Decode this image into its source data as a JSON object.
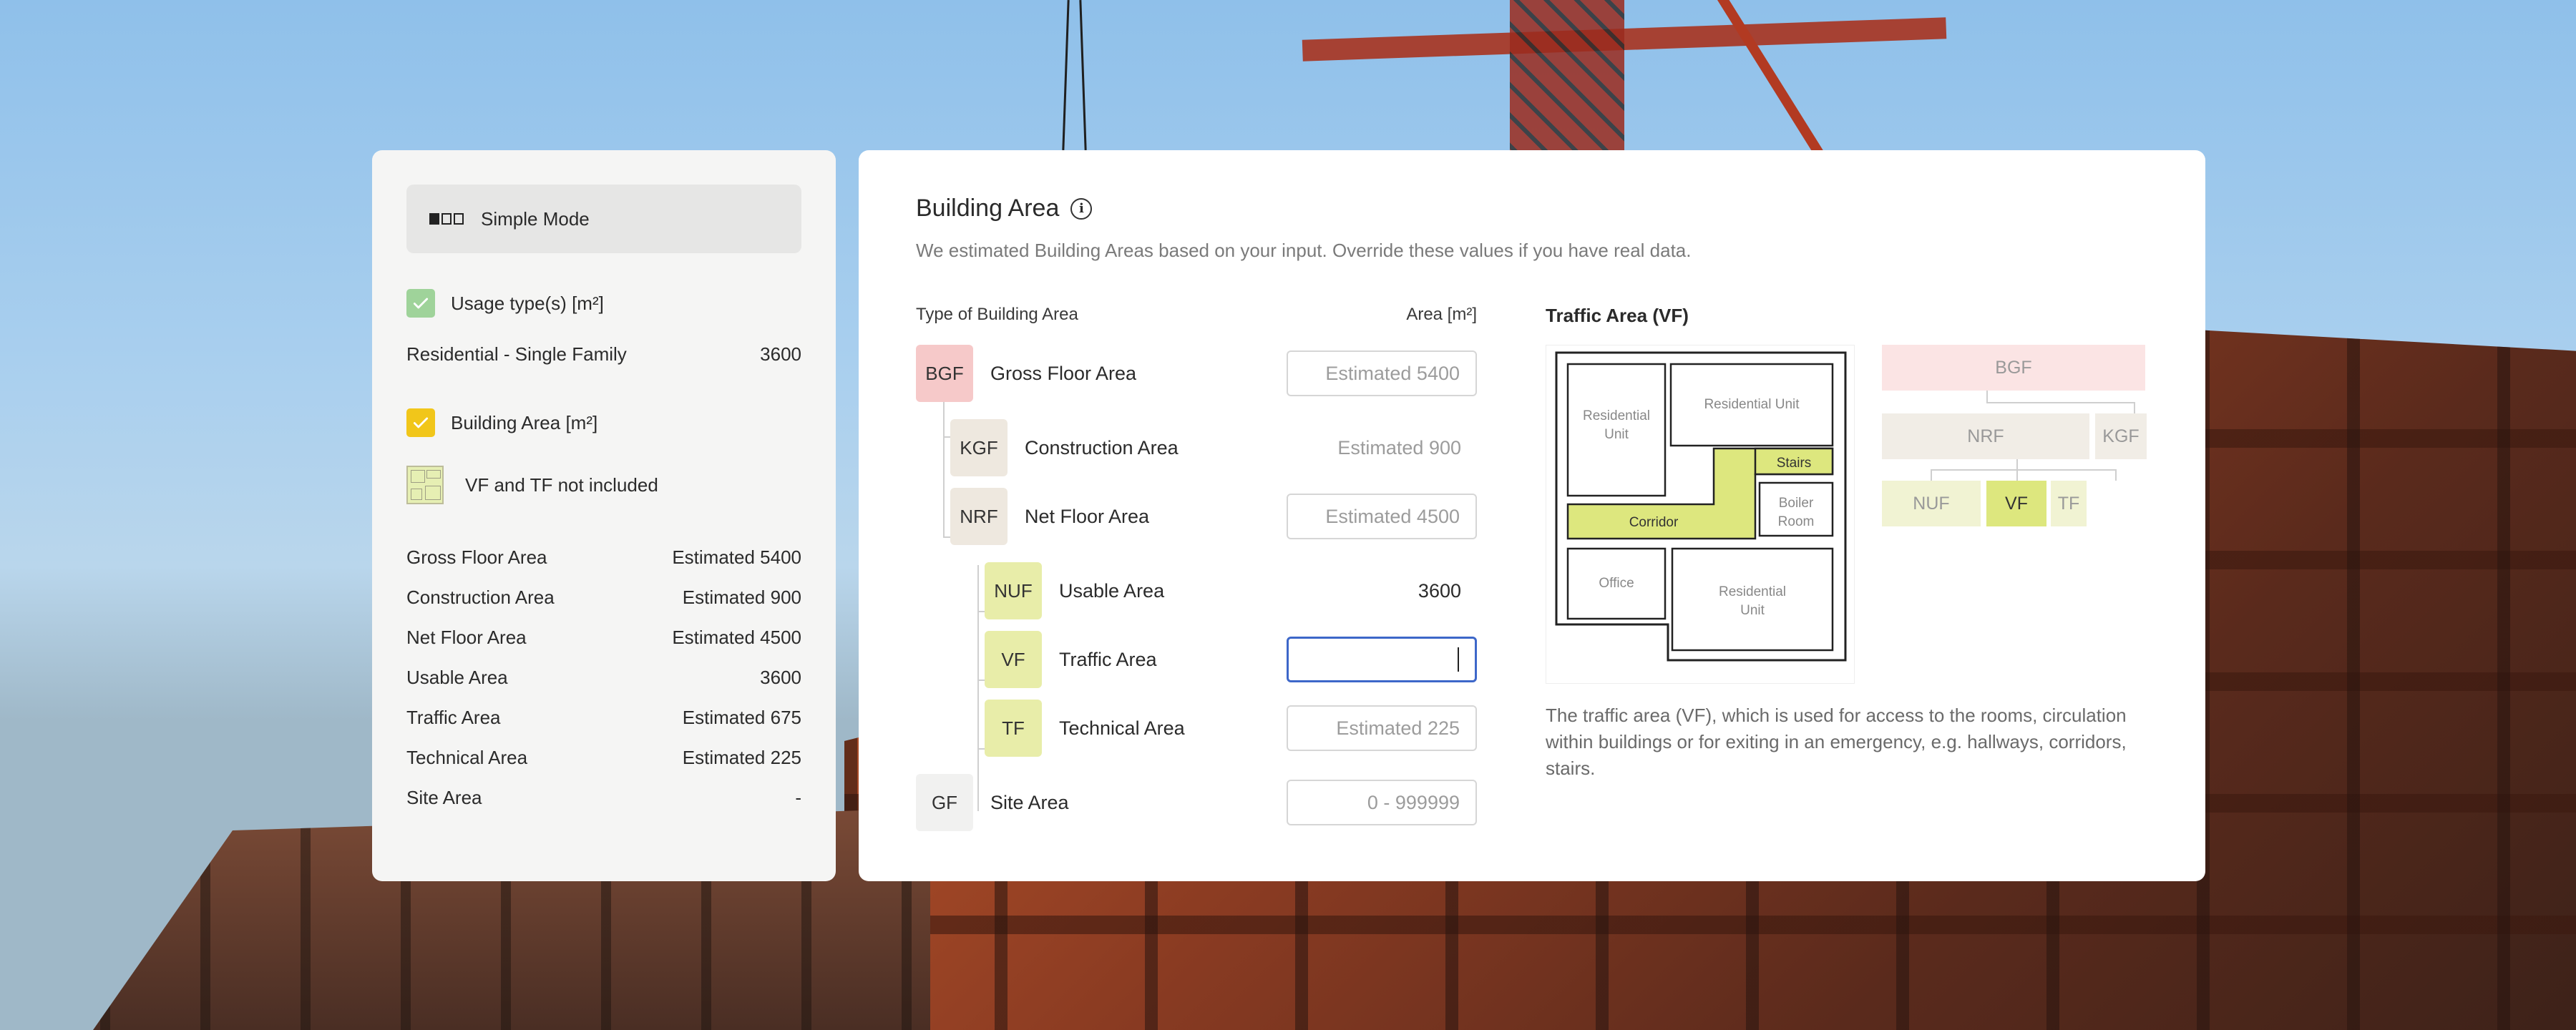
{
  "sidebar": {
    "mode_label": "Simple Mode",
    "usage_heading": "Usage type(s) [m²]",
    "usage_item": {
      "label": "Residential - Single Family",
      "value": "3600"
    },
    "building_heading": "Building Area [m²]",
    "note": "VF and TF not included",
    "areas": [
      {
        "label": "Gross Floor Area",
        "value": "Estimated 5400"
      },
      {
        "label": "Construction Area",
        "value": "Estimated 900"
      },
      {
        "label": "Net Floor Area",
        "value": "Estimated 4500"
      },
      {
        "label": "Usable Area",
        "value": "3600"
      },
      {
        "label": "Traffic Area",
        "value": "Estimated 675"
      },
      {
        "label": "Technical Area",
        "value": "Estimated 225"
      },
      {
        "label": "Site Area",
        "value": "-"
      }
    ]
  },
  "main": {
    "title": "Building Area",
    "subtitle": "We estimated Building Areas based on your input. Override these values if you have real data.",
    "col_type": "Type of Building Area",
    "col_area": "Area [m²]",
    "rows": [
      {
        "tag": "BGF",
        "label": "Gross Floor Area",
        "placeholder": "Estimated 5400"
      },
      {
        "tag": "KGF",
        "label": "Construction Area",
        "value": "Estimated 900"
      },
      {
        "tag": "NRF",
        "label": "Net Floor Area",
        "placeholder": "Estimated 4500"
      },
      {
        "tag": "NUF",
        "label": "Usable Area",
        "value": "3600"
      },
      {
        "tag": "VF",
        "label": "Traffic Area",
        "value": ""
      },
      {
        "tag": "TF",
        "label": "Technical Area",
        "placeholder": "Estimated 225"
      },
      {
        "tag": "GF",
        "label": "Site Area",
        "placeholder": "0 - 999999"
      }
    ]
  },
  "detail": {
    "title": "Traffic Area (VF)",
    "plan_rooms": {
      "residential_unit_left": "Residential Unit",
      "residential_unit_top": "Residential Unit",
      "stairs": "Stairs",
      "boiler_room": "Boiler Room",
      "corridor": "Corridor",
      "office": "Office",
      "residential_unit_bottom": "Residential Unit"
    },
    "hierarchy": {
      "bgf": "BGF",
      "nrf": "NRF",
      "kgf": "KGF",
      "nuf": "NUF",
      "vf": "VF",
      "tf": "TF"
    },
    "description": "The traffic area (VF), which is used for access to the rooms, circulation within buildings or for exiting in an emergency, e.g. hallways, corridors, stairs."
  },
  "colors": {
    "bgf": "#f6c9c9",
    "nrf_kgf": "#eee8df",
    "nuf_vf_tf": "#e8eda9",
    "vf_highlight": "#dde77e",
    "active_border": "#3d67c9",
    "usage_check": "#9fd39a",
    "building_check": "#f1c61a"
  }
}
